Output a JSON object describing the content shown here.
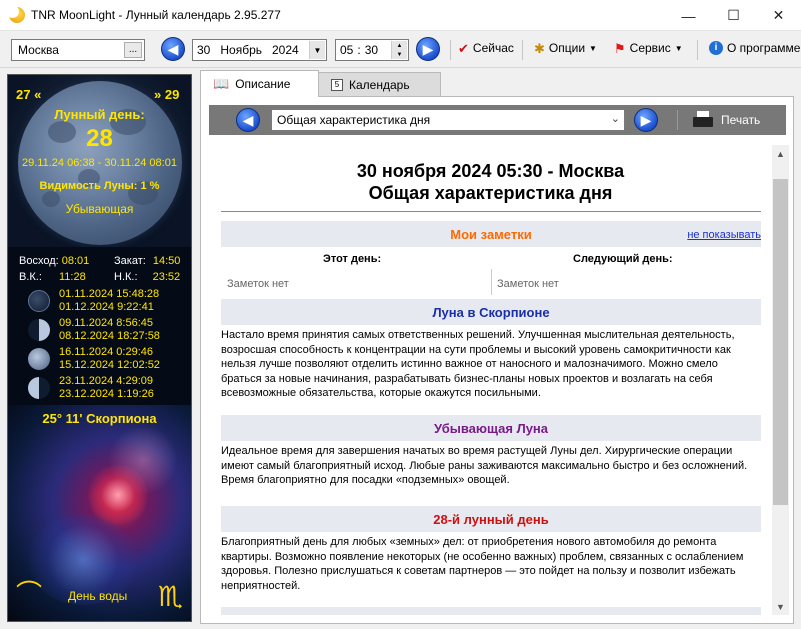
{
  "window": {
    "title": "TNR MoonLight - Лунный календарь 2.95.277",
    "minimize": "—",
    "maximize": "☐",
    "close": "✕"
  },
  "toolbar": {
    "city": "Москва",
    "city_browse": "...",
    "date_day": "30",
    "date_month": "Ноябрь",
    "date_year": "2024",
    "time_hour": "05",
    "time_sep": ":",
    "time_min": "30",
    "now_label": "Сейчас",
    "options_label": "Опции",
    "service_label": "Сервис",
    "about_label": "О программе"
  },
  "left": {
    "prev_day": "27 «",
    "next_day": "» 29",
    "lunar_day_label": "Лунный день:",
    "lunar_day_number": "28",
    "lunar_day_range": "29.11.24 06:38 - 30.11.24 08:01",
    "visibility": "Видимость Луны: 1 %",
    "phase": "Убывающая",
    "rise_label": "Восход:",
    "rise_value": "08:01",
    "set_label": "Закат:",
    "set_value": "14:50",
    "upper_label": "В.К.:",
    "upper_value": "11:28",
    "lower_label": "Н.К.:",
    "lower_value": "23:52",
    "phases": [
      {
        "dates": [
          "01.11.2024 15:48:28",
          "01.12.2024 9:22:41"
        ]
      },
      {
        "dates": [
          "09.11.2024 8:56:45",
          "08.12.2024 18:27:58"
        ]
      },
      {
        "dates": [
          "16.11.2024 0:29:46",
          "15.12.2024 12:02:52"
        ]
      },
      {
        "dates": [
          "23.11.2024 4:29:09",
          "23.12.2024 1:19:26"
        ]
      }
    ],
    "zodiac": "25° 11' Скорпиона",
    "element_day": "День воды"
  },
  "tabs": {
    "description": "Описание",
    "calendar": "Календарь"
  },
  "content": {
    "section_select": "Общая характеристика дня",
    "print_label": "Печать",
    "heading_line1": "30 ноября 2024 05:30 - Москва",
    "heading_line2": "Общая характеристика дня",
    "notes_title": "Мои заметки",
    "hide_link": "не показывать",
    "this_day": "Этот день:",
    "next_day": "Следующий день:",
    "no_notes_1": "Заметок нет",
    "no_notes_2": "Заметок нет",
    "moon_sign_title": "Луна в Скорпионе",
    "moon_sign_text": "Настало время принятия самых ответственных решений. Улучшенная мыслительная деятельность, возросшая способность к концентрации на сути проблемы и высокий уровень самокритичности как нельзя лучше позволяют отделить истинно важное от наносного и малозначимого. Можно смело браться за новые начинания, разрабатывать бизнес-планы новых проектов и возлагать на себя всевозможные обязательства, которые окажутся посильными.",
    "waning_title": "Убывающая Луна",
    "waning_text": "Идеальное время для завершения начатых во время растущей Луны дел. Хирургические операции имеют самый благоприятный исход. Любые раны заживаются максимально быстро и без осложнений. Время благоприятно для посадки «подземных» овощей.",
    "lunar_day_title": "28-й лунный день",
    "lunar_day_text": "Благоприятный день для любых «земных» дел: от приобретения нового автомобиля до ремонта квартиры. Возможно появление некоторых (не особенно важных) проблем, связанных с ослаблением здоровья. Полезно прислушаться к советам партнеров — это пойдет на пользу и позволит избежать неприятностей."
  },
  "colors": {
    "notes_title": "#ff6a00",
    "moon_sign_title": "#1a2fa8",
    "waning_title": "#7a1a8a",
    "lunar_day_title": "#d01010",
    "moon_text": "#ffe600"
  },
  "icons": {
    "nav_prev": "arrow-left-circle-icon",
    "nav_next": "arrow-right-circle-icon",
    "now": "check-icon",
    "options": "gear-icon",
    "service": "flag-icon",
    "about": "info-icon",
    "print": "printer-icon"
  }
}
